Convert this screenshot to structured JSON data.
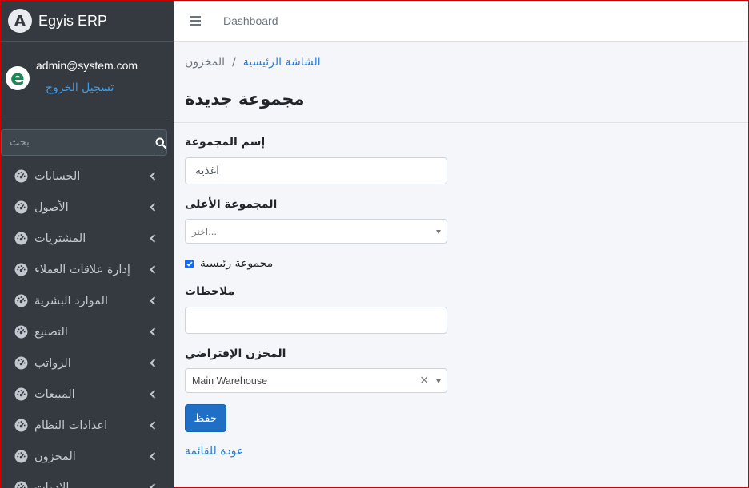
{
  "brand": {
    "logo_letter": "A",
    "name": "Egyis ERP"
  },
  "user": {
    "avatar_letter": "e",
    "email": "admin@system.com",
    "logout_label": "تسجيل الخروج"
  },
  "search": {
    "placeholder": "بحث",
    "icon": "search-icon"
  },
  "sidebar": {
    "items": [
      {
        "label": "الحسابات",
        "icon": "tachometer-icon"
      },
      {
        "label": "الأصول",
        "icon": "tachometer-icon"
      },
      {
        "label": "المشتريات",
        "icon": "tachometer-icon"
      },
      {
        "label": "إدارة علاقات العملاء",
        "icon": "tachometer-icon"
      },
      {
        "label": "الموارد البشرية",
        "icon": "tachometer-icon"
      },
      {
        "label": "التصنيع",
        "icon": "tachometer-icon"
      },
      {
        "label": "الرواتب",
        "icon": "tachometer-icon"
      },
      {
        "label": "المبيعات",
        "icon": "tachometer-icon"
      },
      {
        "label": "اعدادات النظام",
        "icon": "tachometer-icon"
      },
      {
        "label": "المخزون",
        "icon": "tachometer-icon"
      },
      {
        "label": "الادوات",
        "icon": "tachometer-icon"
      }
    ]
  },
  "navbar": {
    "menu_icon": "hamburger-icon",
    "dashboard_label": "Dashboard"
  },
  "breadcrumb": {
    "home": "الشاشة الرئيسية",
    "separator": "/",
    "current": "المخزون"
  },
  "page": {
    "title": "مجموعة جديدة"
  },
  "form": {
    "group_name": {
      "label": "إسم المجموعة",
      "value": "اغذية"
    },
    "parent_group": {
      "label": "المجموعة الأعلى",
      "placeholder": "اختر..."
    },
    "main_group": {
      "label": "مجموعة رئيسية",
      "checked": true
    },
    "notes": {
      "label": "ملاحظات",
      "value": ""
    },
    "default_store": {
      "label": "المخزن الإفتراضي",
      "value": "Main Warehouse",
      "clear": "×"
    }
  },
  "actions": {
    "save_label": "حفظ",
    "back_label": "عودة للقائمة"
  },
  "colors": {
    "sidebar_bg": "#343a40",
    "link": "#2a7bd2",
    "primary": "#1e6fc5",
    "content_bg": "#f4f6f9"
  }
}
